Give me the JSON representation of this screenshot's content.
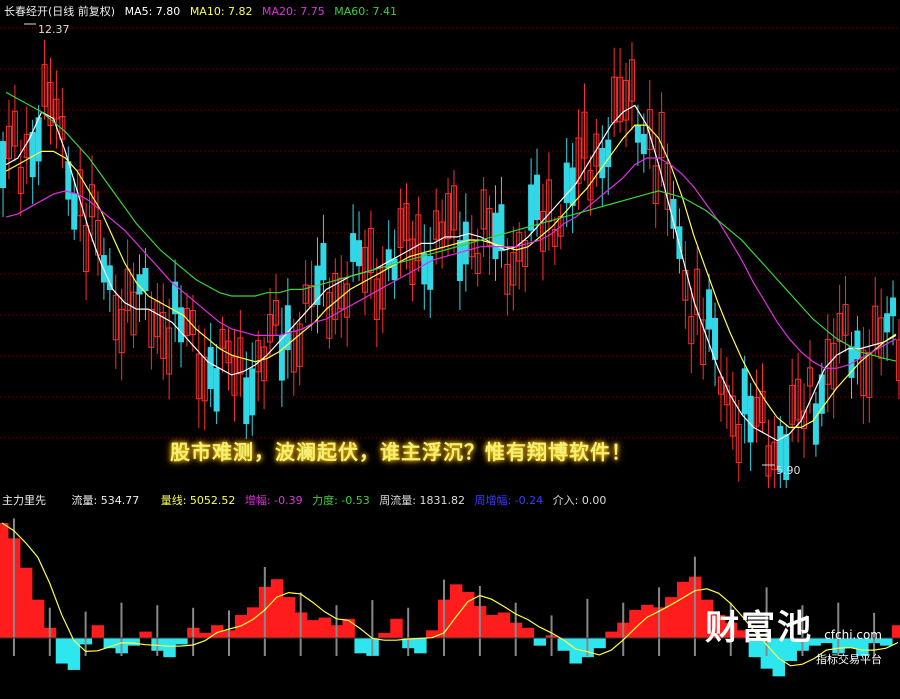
{
  "top_header": {
    "title": "长春经开(日线 前复权)",
    "ma5": "MA5: 7.80",
    "ma10": "MA10: 7.82",
    "ma20": "MA20: 7.75",
    "ma60": "MA60: 7.41"
  },
  "price_annotations": {
    "high": "12.37",
    "low": "5.90"
  },
  "slogan": "股市难测，波澜起伏，谁主浮沉？惟有翔博软件！",
  "bottom_header": {
    "indicator": "主力里先",
    "flow": "流量: 534.77",
    "volume_line": "量线: 5052.52",
    "amp": "增幅: -0.39",
    "force": "力度: -0.53",
    "week_flow": "周流量: 1831.82",
    "week_amp": "周增幅: -0.24",
    "enter": "介入: 0.00"
  },
  "brand": {
    "name": "财富池",
    "site": "cfchi.com",
    "tagline": "指标交易平台"
  },
  "colors": {
    "up": "#ff2f2f",
    "down": "#32d7e6",
    "ma5": "#ffffff",
    "ma10": "#ffff4a",
    "ma20": "#e02ee0",
    "ma60": "#3ad33a",
    "flow_pos": "#ff1c1c",
    "flow_neg": "#2ee6ee"
  },
  "chart_data": [
    {
      "type": "candlestick",
      "title": "长春经开(日线 前复权)",
      "ylim": [
        5.6,
        12.6
      ],
      "series": [
        {
          "name": "MA5",
          "values": [
            10.4,
            10.5,
            10.8,
            11.2,
            11.1,
            10.6,
            10.0,
            9.4,
            8.9,
            8.5,
            8.3,
            8.2,
            8.2,
            8.1,
            8.0,
            7.8,
            7.6,
            7.4,
            7.3,
            7.2,
            7.25,
            7.35,
            7.5,
            7.7,
            7.9,
            8.1,
            8.3,
            8.5,
            8.6,
            8.7,
            8.75,
            8.8,
            8.9,
            9.0,
            9.1,
            9.2,
            9.2,
            9.3,
            9.3,
            9.35,
            9.3,
            9.2,
            9.1,
            9.15,
            9.3,
            9.5,
            9.7,
            9.9,
            10.1,
            10.4,
            10.7,
            11.0,
            11.2,
            11.3,
            11.0,
            10.4,
            9.7,
            9.0,
            8.3,
            7.8,
            7.3,
            6.9,
            6.6,
            6.4,
            6.3,
            6.2,
            6.3,
            6.5,
            6.9,
            7.3,
            7.5,
            7.6,
            7.6,
            7.65,
            7.7,
            7.8
          ]
        },
        {
          "name": "MA10",
          "values": [
            10.3,
            10.4,
            10.5,
            10.6,
            10.6,
            10.5,
            10.3,
            10.0,
            9.7,
            9.3,
            8.9,
            8.6,
            8.4,
            8.3,
            8.2,
            8.1,
            7.9,
            7.75,
            7.6,
            7.5,
            7.45,
            7.4,
            7.45,
            7.55,
            7.7,
            7.85,
            8.0,
            8.2,
            8.35,
            8.5,
            8.6,
            8.7,
            8.8,
            8.9,
            9.0,
            9.05,
            9.1,
            9.15,
            9.2,
            9.25,
            9.25,
            9.2,
            9.15,
            9.1,
            9.15,
            9.3,
            9.45,
            9.65,
            9.85,
            10.05,
            10.3,
            10.55,
            10.8,
            11.0,
            11.0,
            10.8,
            10.4,
            9.9,
            9.3,
            8.8,
            8.3,
            7.85,
            7.45,
            7.1,
            6.8,
            6.55,
            6.4,
            6.4,
            6.5,
            6.75,
            7.0,
            7.2,
            7.4,
            7.55,
            7.7,
            7.82
          ]
        },
        {
          "name": "MA20",
          "values": [
            9.6,
            9.65,
            9.75,
            9.85,
            9.95,
            10.0,
            9.95,
            9.85,
            9.7,
            9.55,
            9.4,
            9.2,
            9.0,
            8.8,
            8.6,
            8.45,
            8.3,
            8.15,
            8.0,
            7.9,
            7.85,
            7.8,
            7.8,
            7.8,
            7.85,
            7.9,
            8.0,
            8.05,
            8.15,
            8.25,
            8.35,
            8.45,
            8.55,
            8.65,
            8.75,
            8.85,
            8.95,
            9.0,
            9.05,
            9.1,
            9.15,
            9.15,
            9.15,
            9.15,
            9.2,
            9.25,
            9.35,
            9.5,
            9.6,
            9.75,
            9.9,
            10.05,
            10.2,
            10.4,
            10.5,
            10.5,
            10.4,
            10.25,
            10.05,
            9.8,
            9.55,
            9.25,
            8.95,
            8.6,
            8.3,
            8.0,
            7.75,
            7.55,
            7.4,
            7.3,
            7.3,
            7.35,
            7.45,
            7.55,
            7.65,
            7.75
          ]
        },
        {
          "name": "MA60",
          "values": [
            11.5,
            11.4,
            11.3,
            11.2,
            11.05,
            10.9,
            10.7,
            10.5,
            10.25,
            10.0,
            9.75,
            9.5,
            9.3,
            9.1,
            8.95,
            8.8,
            8.65,
            8.55,
            8.45,
            8.4,
            8.4,
            8.4,
            8.45,
            8.45,
            8.5,
            8.5,
            8.55,
            8.6,
            8.65,
            8.7,
            8.75,
            8.8,
            8.85,
            8.9,
            8.95,
            9.0,
            9.05,
            9.1,
            9.15,
            9.2,
            9.25,
            9.3,
            9.35,
            9.4,
            9.45,
            9.5,
            9.55,
            9.6,
            9.65,
            9.7,
            9.75,
            9.8,
            9.85,
            9.9,
            9.95,
            10.0,
            9.95,
            9.9,
            9.8,
            9.7,
            9.55,
            9.4,
            9.25,
            9.05,
            8.85,
            8.65,
            8.45,
            8.25,
            8.05,
            7.9,
            7.75,
            7.65,
            7.55,
            7.5,
            7.45,
            7.41
          ]
        }
      ],
      "annotations": [
        {
          "text": "12.37",
          "x": 3,
          "y": 12.37
        },
        {
          "text": "5.90",
          "x": 66,
          "y": 5.9
        }
      ]
    },
    {
      "type": "bar",
      "title": "主力里先",
      "values": [
        90,
        78,
        55,
        30,
        8,
        -20,
        -25,
        -5,
        10,
        -8,
        -12,
        -6,
        5,
        -10,
        -15,
        -5,
        8,
        4,
        10,
        6,
        18,
        24,
        40,
        46,
        32,
        20,
        14,
        16,
        10,
        15,
        -12,
        -14,
        4,
        15,
        -8,
        -12,
        6,
        30,
        42,
        36,
        25,
        18,
        20,
        12,
        8,
        -6,
        2,
        -10,
        -20,
        -15,
        -8,
        5,
        12,
        22,
        26,
        24,
        32,
        44,
        48,
        30,
        18,
        12,
        6,
        -15,
        -24,
        -30,
        -18,
        -10,
        -6,
        -4,
        -12,
        -8,
        -14,
        -4,
        -6,
        10
      ]
    }
  ]
}
